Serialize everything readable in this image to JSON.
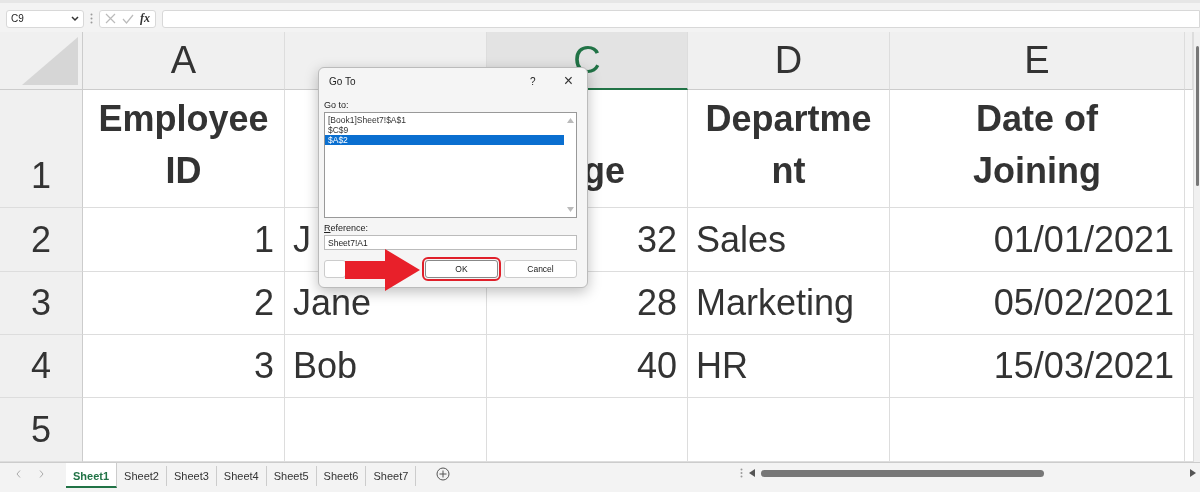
{
  "formula_bar": {
    "name_box": "C9",
    "function_label": "fx"
  },
  "grid": {
    "columns": [
      {
        "label": "A",
        "selected": false
      },
      {
        "selected": false
      },
      {
        "label": "C",
        "selected": true
      },
      {
        "label": "D",
        "selected": false
      },
      {
        "label": "E",
        "selected": false
      }
    ],
    "rows": [
      {
        "label": "1",
        "cells": [
          {
            "text": "Employee ID",
            "kind": "header"
          },
          null,
          {
            "text": "ge",
            "kind": "header"
          },
          {
            "text": "Department",
            "kind": "header"
          },
          {
            "text": "Date of Joining",
            "kind": "header"
          }
        ]
      },
      {
        "label": "2",
        "cells": [
          {
            "text": "1",
            "kind": "number"
          },
          {
            "text": "J",
            "kind": "text"
          },
          {
            "text": "32",
            "kind": "number"
          },
          {
            "text": "Sales",
            "kind": "text"
          },
          {
            "text": "01/01/2021",
            "kind": "number"
          }
        ]
      },
      {
        "label": "3",
        "cells": [
          {
            "text": "2",
            "kind": "number"
          },
          {
            "text": "Jane",
            "kind": "text"
          },
          {
            "text": "28",
            "kind": "number"
          },
          {
            "text": "Marketing",
            "kind": "text"
          },
          {
            "text": "05/02/2021",
            "kind": "number"
          }
        ]
      },
      {
        "label": "4",
        "cells": [
          {
            "text": "3",
            "kind": "number"
          },
          {
            "text": "Bob",
            "kind": "text"
          },
          {
            "text": "40",
            "kind": "number"
          },
          {
            "text": "HR",
            "kind": "text"
          },
          {
            "text": "15/03/2021",
            "kind": "number"
          }
        ]
      },
      {
        "label": "5",
        "cells": []
      }
    ]
  },
  "dialog": {
    "title": "Go To",
    "help": "?",
    "close": "×",
    "list_label": "Go to:",
    "items": [
      {
        "text": "[Book1]Sheet7!$A$1",
        "selected": false
      },
      {
        "text": "$C$9",
        "selected": false
      },
      {
        "text": "$A$2",
        "selected": true
      }
    ],
    "reference_label": "Reference:",
    "reference": "Sheet7!A1",
    "buttons": [
      {
        "label": "OK",
        "highlighted": true
      },
      {
        "label": "Cancel",
        "highlighted": false
      }
    ]
  },
  "sheet_tabs": [
    {
      "label": "Sheet1",
      "selected": true
    },
    {
      "label": "Sheet2",
      "selected": false
    },
    {
      "label": "Sheet3",
      "selected": false
    },
    {
      "label": "Sheet4",
      "selected": false
    },
    {
      "label": "Sheet5",
      "selected": false
    },
    {
      "label": "Sheet6",
      "selected": false
    },
    {
      "label": "Sheet7",
      "selected": false
    }
  ]
}
